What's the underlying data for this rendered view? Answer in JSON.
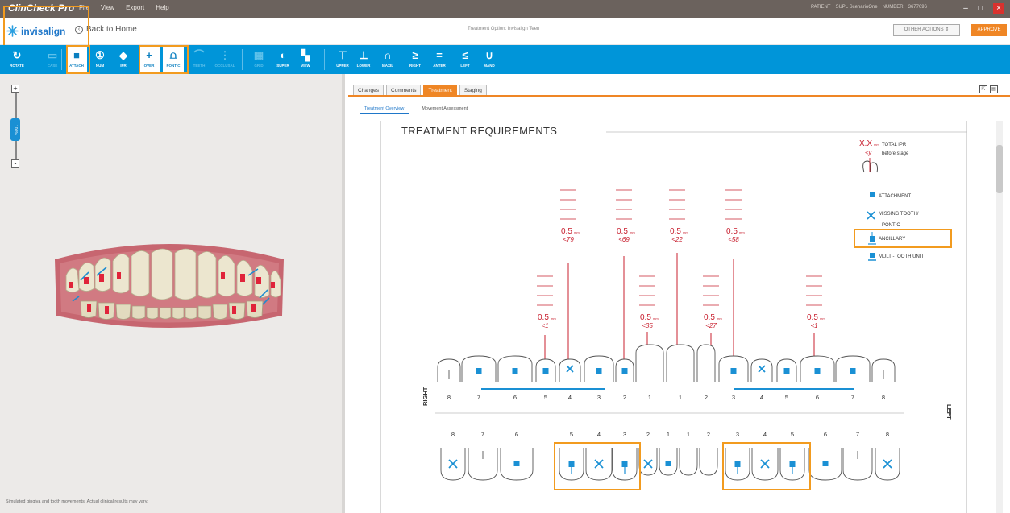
{
  "app": {
    "name": "ClinCheck Pro"
  },
  "menu": {
    "file": "File",
    "view": "View",
    "export": "Export",
    "help": "Help"
  },
  "patient_bar": {
    "patient": "PATIENT",
    "name": "SUPL ScenarioOne",
    "number_label": "NUMBER",
    "number": "3677096"
  },
  "window_controls": {
    "minimize": "–",
    "maximize": "□",
    "close": "×"
  },
  "header": {
    "logo_text": "invisalign",
    "back_label": "Back to Home",
    "treatment_option": "Treatment Option: Invisalign Teen",
    "other_actions": "OTHER ACTIONS ⇕",
    "approve": "APPROVE"
  },
  "toolbar": {
    "tools": [
      {
        "icon": "rotate-icon",
        "glyph": "↻",
        "label": "ROTATE",
        "state": "normal"
      },
      {
        "icon": "case-icon",
        "glyph": "▭",
        "label": "CASE",
        "state": "dim"
      },
      {
        "icon": "attach-icon",
        "glyph": "■",
        "label": "ATTACH",
        "state": "active"
      },
      {
        "icon": "num-icon",
        "glyph": "①",
        "label": "NUM",
        "state": "normal"
      },
      {
        "icon": "ipr-icon",
        "glyph": "◆",
        "label": "IPR",
        "state": "normal"
      },
      {
        "icon": "over-icon",
        "glyph": "+",
        "label": "OVER",
        "state": "active"
      },
      {
        "icon": "pontic-icon",
        "glyph": "⩍",
        "label": "PONTIC",
        "state": "active"
      },
      {
        "icon": "teeth-icon",
        "glyph": "⌒",
        "label": "TEETH",
        "state": "dim"
      },
      {
        "icon": "occlusal-icon",
        "glyph": "⋮",
        "label": "OCCLUSAL",
        "state": "dim"
      },
      {
        "icon": "grid-icon",
        "glyph": "▦",
        "label": "GRID",
        "state": "dim"
      },
      {
        "icon": "super-icon",
        "glyph": "◐",
        "label": "SUPER",
        "state": "normal"
      },
      {
        "icon": "view-icon",
        "glyph": "▚",
        "label": "VIEW",
        "state": "normal"
      },
      {
        "icon": "upper-icon",
        "glyph": "⊤",
        "label": "UPPER",
        "state": "normal"
      },
      {
        "icon": "lower-icon",
        "glyph": "⊥",
        "label": "LOWER",
        "state": "normal"
      },
      {
        "icon": "maxil-icon",
        "glyph": "∩",
        "label": "MAXIL",
        "state": "normal"
      },
      {
        "icon": "right-icon",
        "glyph": "≥",
        "label": "RIGHT",
        "state": "normal"
      },
      {
        "icon": "anter-icon",
        "glyph": "=",
        "label": "ANTER",
        "state": "normal"
      },
      {
        "icon": "left-icon",
        "glyph": "≤",
        "label": "LEFT",
        "state": "normal"
      },
      {
        "icon": "mand-icon",
        "glyph": "∪",
        "label": "MAND",
        "state": "normal"
      }
    ]
  },
  "left_pane": {
    "zoom_label": "100%",
    "disclaimer": "Simulated gingiva and tooth movements. Actual clinical results may vary."
  },
  "right_pane": {
    "tabs": [
      "Changes",
      "Comments",
      "Treatment",
      "Staging"
    ],
    "active_tab": "Treatment",
    "subtabs": [
      "Treatment Overview",
      "Movement Assessment"
    ],
    "title": "TREATMENT REQUIREMENTS"
  },
  "legend": {
    "total_ipr_value": "X.X",
    "total_ipr_unit": "mm",
    "total_ipr_label": "TOTAL IPR",
    "before_stage_value": "<y",
    "before_stage_label": "before stage",
    "attachment": "ATTACHMENT",
    "missing_tooth": "MISSING TOOTH/",
    "pontic": "PONTIC",
    "ancillary": "ANCILLARY",
    "multi_tooth": "MULTI-TOOTH UNIT"
  },
  "ipr_markers": [
    {
      "value": "0.5",
      "unit": "mm",
      "stage": "<1"
    },
    {
      "value": "0.5",
      "unit": "mm",
      "stage": "<79"
    },
    {
      "value": "0.5",
      "unit": "mm",
      "stage": "<69"
    },
    {
      "value": "0.5",
      "unit": "mm",
      "stage": "<35"
    },
    {
      "value": "0.5",
      "unit": "mm",
      "stage": "<22"
    },
    {
      "value": "0.5",
      "unit": "mm",
      "stage": "<27"
    },
    {
      "value": "0.5",
      "unit": "mm",
      "stage": "<58"
    },
    {
      "value": "0.5",
      "unit": "mm",
      "stage": "<1"
    }
  ],
  "upper_numbers": [
    "8",
    "7",
    "6",
    "5",
    "4",
    "3",
    "2",
    "1",
    "1",
    "2",
    "3",
    "4",
    "5",
    "6",
    "7",
    "8"
  ],
  "lower_numbers": [
    "8",
    "7",
    "6",
    "5",
    "4",
    "3",
    "2",
    "1",
    "1",
    "2",
    "3",
    "4",
    "5",
    "6",
    "7",
    "8"
  ],
  "side_labels": {
    "right": "RIGHT",
    "left": "LEFT"
  },
  "colors": {
    "accent": "#0095d9",
    "highlight": "#f29b1f",
    "ipr_red": "#c8202f",
    "approve": "#ef8625"
  }
}
